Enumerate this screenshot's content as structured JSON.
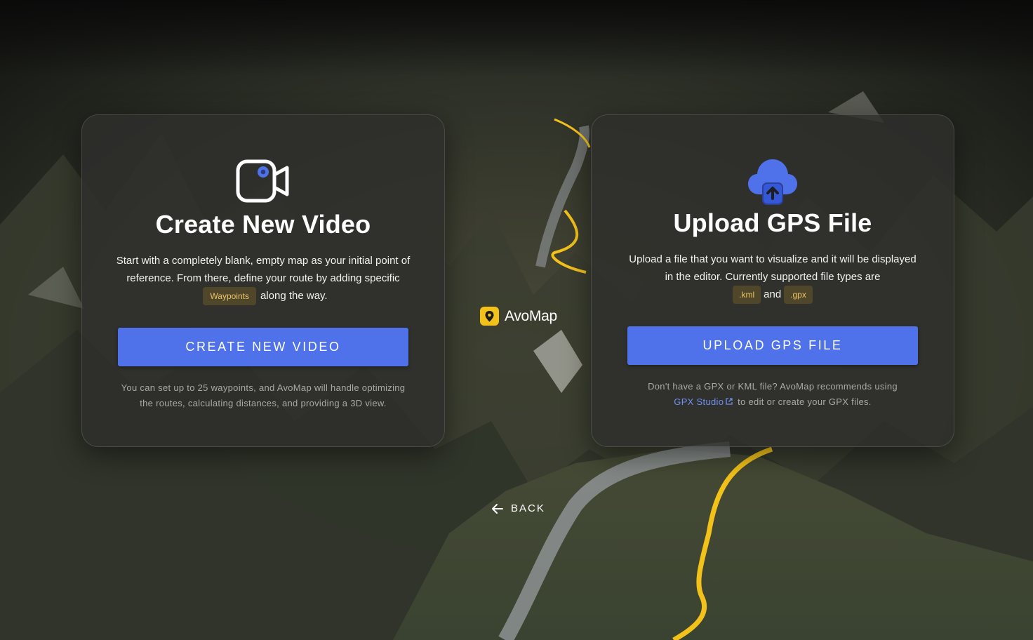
{
  "left_card": {
    "icon": "video-camera-icon",
    "title": "Create New Video",
    "desc_part1": "Start with a completely blank, empty map as your initial point of reference. From there, define your route by adding specific",
    "chip": "Waypoints",
    "desc_part2": "along the way.",
    "button": "CREATE NEW VIDEO",
    "note": "You can set up to 25 waypoints, and AvoMap will handle optimizing the routes, calculating distances, and providing a 3D view."
  },
  "right_card": {
    "icon": "cloud-upload-icon",
    "title": "Upload GPS File",
    "desc_part1": "Upload a file that you want to visualize and it will be displayed in the editor. Currently supported file types are",
    "chip_kml": ".kml",
    "and_word": "and",
    "chip_gpx": ".gpx",
    "button": "UPLOAD GPS FILE",
    "note_part1": "Don't have a GPX or KML file? AvoMap recommends using",
    "link": "GPX Studio",
    "note_part2": "to edit or create your GPX files."
  },
  "logo": {
    "name": "AvoMap",
    "icon": "avomap-logo-icon"
  },
  "back": {
    "label": "BACK",
    "icon": "arrow-left-icon"
  },
  "colors": {
    "accent": "#4f72ea",
    "chip_text": "#e9c36a",
    "route_yellow": "#f2c21b",
    "link": "#6f8ff2"
  }
}
